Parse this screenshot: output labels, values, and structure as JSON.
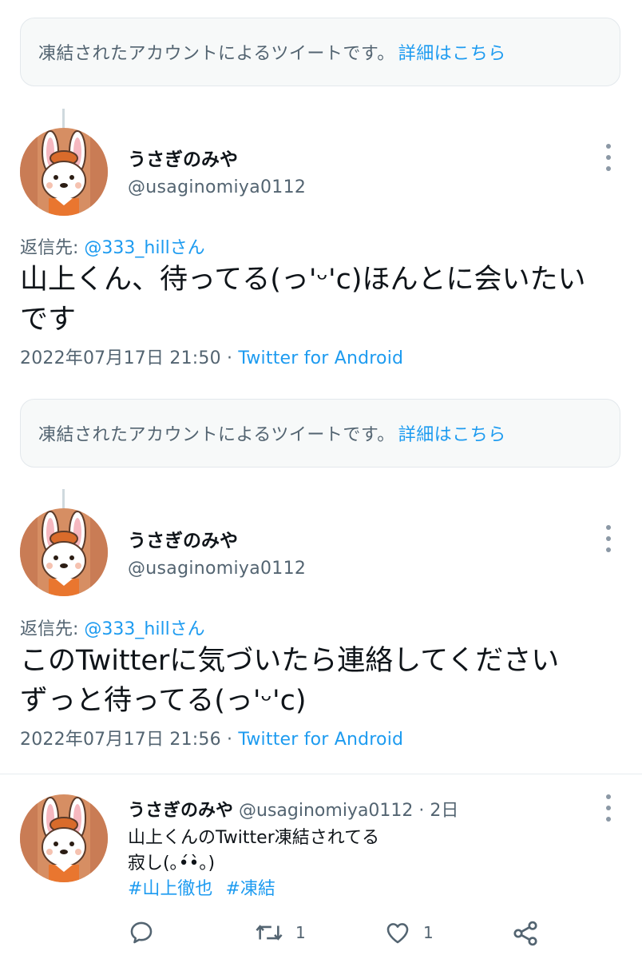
{
  "frozen_notice": {
    "text": "凍結されたアカウントによるツイートです。",
    "link": "詳細はこちら"
  },
  "tweets": [
    {
      "display_name": "うさぎのみや",
      "handle": "@usaginomiya0112",
      "reply_label": "返信先: ",
      "reply_mention": "@333_hillさん",
      "text": "山上くん、待ってる(っ'ᵕ'c)ほんとに会いたい\nです",
      "timestamp": "2022年07月17日 21:50 · ",
      "source": "Twitter for Android"
    },
    {
      "display_name": "うさぎのみや",
      "handle": "@usaginomiya0112",
      "reply_label": "返信先: ",
      "reply_mention": "@333_hillさん",
      "text": "このTwitterに気づいたら連絡してください\nずっと待ってる(っ'ᵕ'c)",
      "timestamp": "2022年07月17日 21:56 · ",
      "source": "Twitter for Android"
    }
  ],
  "compact_tweet": {
    "display_name": "うさぎのみや",
    "handle": "@usaginomiya0112 · 2日",
    "line1": "山上くんのTwitter凍結されてる",
    "line2": "寂し(｡•́•̀｡)",
    "hashtags": [
      "#山上徹也",
      "#凍結"
    ],
    "actions": {
      "reply_count": "",
      "retweet_count": "1",
      "like_count": "1"
    }
  },
  "colors": {
    "accent": "#1d9bf0",
    "secondary_text": "#536471",
    "primary_text": "#0f1419"
  }
}
